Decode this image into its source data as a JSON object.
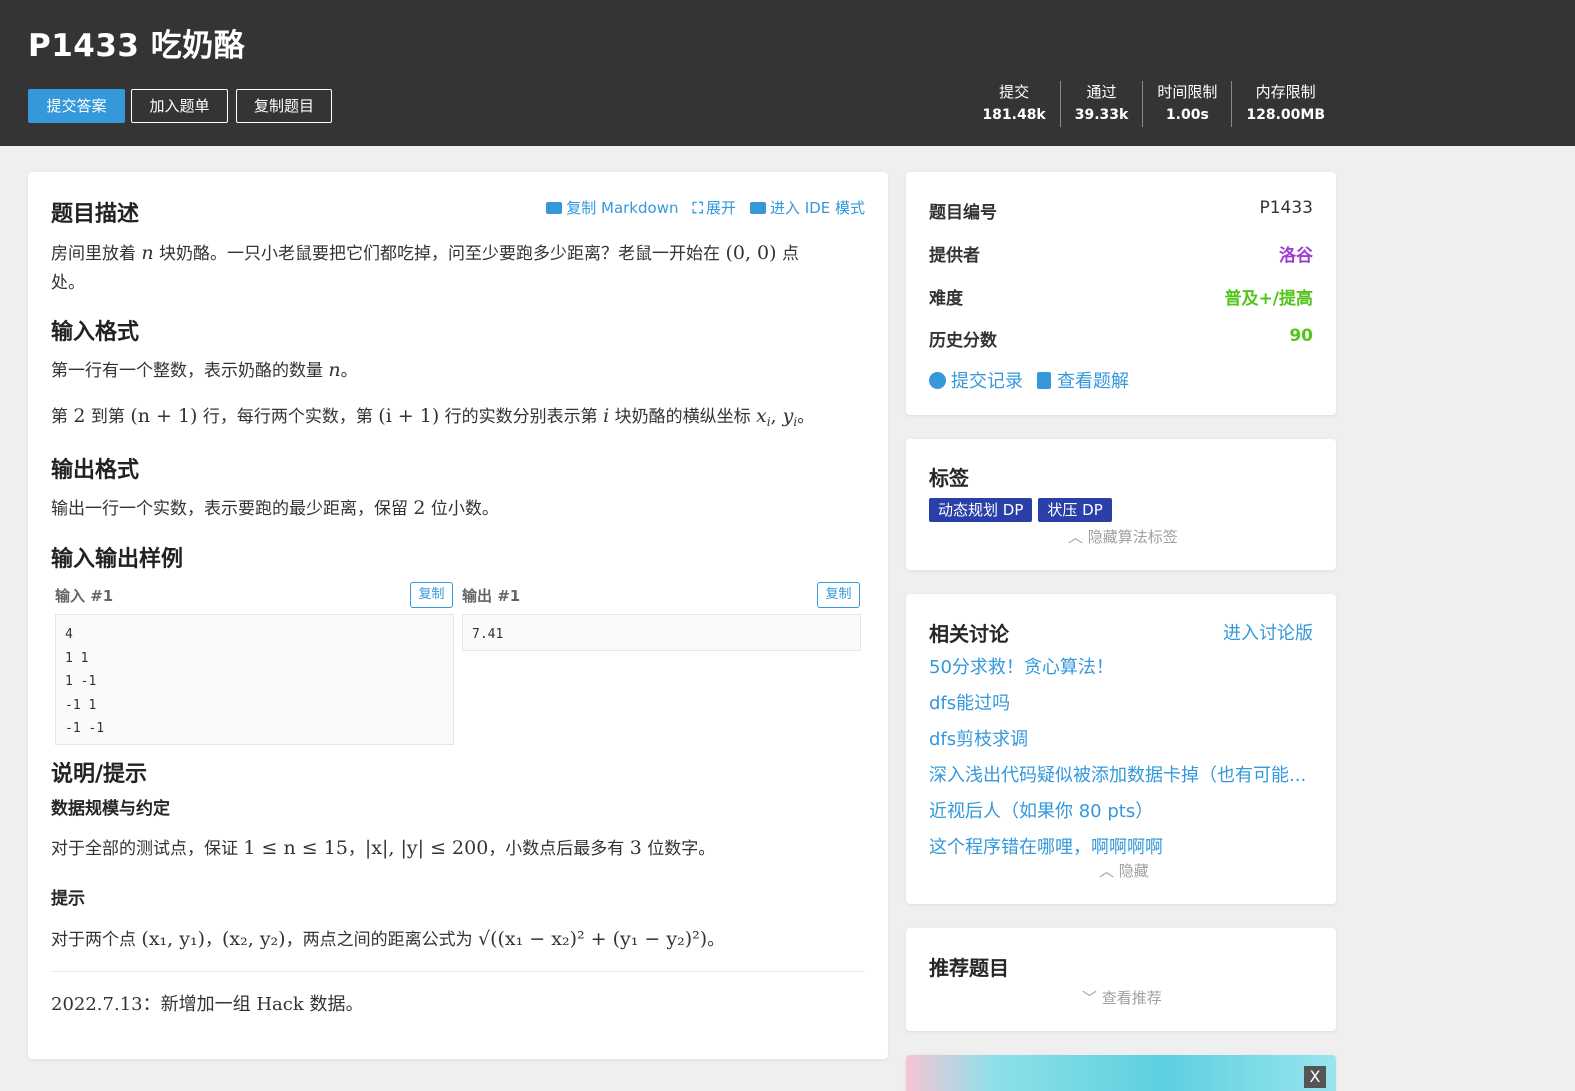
{
  "header": {
    "title": "P1433 吃奶酪",
    "buttons": {
      "submit": "提交答案",
      "add_list": "加入题单",
      "copy": "复制题目"
    },
    "stats": [
      {
        "label": "提交",
        "value": "181.48k"
      },
      {
        "label": "通过",
        "value": "39.33k"
      },
      {
        "label": "时间限制",
        "value": "1.00s"
      },
      {
        "label": "内存限制",
        "value": "128.00MB"
      }
    ]
  },
  "main": {
    "actions": {
      "markdown": "复制 Markdown",
      "expand": "展开",
      "ide": "进入 IDE 模式"
    },
    "desc_title": "题目描述",
    "desc": {
      "a": "房间里放着 ",
      "n": "n",
      "b": " 块奶酪。一只小老鼠要把它们都吃掉，问至少要跑多少距离？老鼠一开始在 ",
      "origin": "(0, 0)",
      "c": " 点",
      "d": "处。"
    },
    "input_title": "输入格式",
    "input1": {
      "a": "第一行有一个整数，表示奶酪的数量 ",
      "n": "n",
      "b": "。"
    },
    "input2": {
      "a": "第 ",
      "two": "2",
      "b": " 到第 ",
      "r1": "(n + 1)",
      "c": " 行，每行两个实数，第 ",
      "r2": "(i + 1)",
      "d": " 行的实数分别表示第 ",
      "i": "i",
      "e": " 块奶酪的横纵坐标 ",
      "x": "x",
      "comma": ", ",
      "y": "y",
      "f": "。"
    },
    "output_title": "输出格式",
    "output": {
      "a": "输出一行一个实数，表示要跑的最少距离，保留 ",
      "two": "2",
      "b": " 位小数。"
    },
    "samples_title": "输入输出样例",
    "sample_in_label": "输入 #1",
    "sample_out_label": "输出 #1",
    "copy_label": "复制",
    "sample_in": "4\n1 1\n1 -1\n-1 1\n-1 -1",
    "sample_out": "7.41",
    "hint_title": "说明/提示",
    "scale_title": "数据规模与约定",
    "scale": {
      "a": "对于全部的测试点，保证 ",
      "range": "1 ≤ n ≤ 15",
      "b": "，",
      "abs": "|x|, |y| ≤ 200",
      "c": "，小数点后最多有 ",
      "three": "3",
      "d": " 位数字。"
    },
    "tip_title": "提示",
    "tip": {
      "a": "对于两个点 ",
      "p1": "(x₁, y₁)",
      "b": "，",
      "p2": "(x₂, y₂)",
      "c": "，两点之间的距离公式为 ",
      "formula": "√((x₁ − x₂)² + (y₁ − y₂)²)",
      "d": "。"
    },
    "update": "2022.7.13：新增加一组 Hack 数据。"
  },
  "info": {
    "rows": [
      {
        "key": "题目编号",
        "value": "P1433",
        "color": "#333333"
      },
      {
        "key": "提供者",
        "value": "洛谷",
        "color": "#9d3dcf"
      },
      {
        "key": "难度",
        "value": "普及+/提高",
        "color": "#52c41a"
      },
      {
        "key": "历史分数",
        "value": "90",
        "color": "#52c41a"
      }
    ],
    "records": "提交记录",
    "solutions": "查看题解"
  },
  "tags": {
    "title": "标签",
    "items": [
      "动态规划 DP",
      "状压 DP"
    ],
    "hide": "隐藏算法标签"
  },
  "discuss": {
    "title": "相关讨论",
    "enter": "进入讨论版",
    "items": [
      "50分求救！贪心算法！",
      "dfs能过吗",
      "dfs剪枝求调",
      "深入浅出代码疑似被添加数据卡掉（也有可能...",
      "近视后人（如果你 80 pts）",
      "这个程序错在哪哩，啊啊啊啊"
    ],
    "hide": "隐藏"
  },
  "recommend": {
    "title": "推荐题目",
    "view": "查看推荐"
  },
  "ad": {
    "close": "X"
  }
}
